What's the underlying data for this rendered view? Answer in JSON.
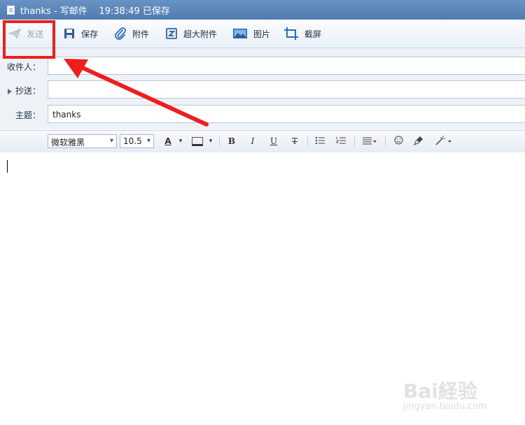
{
  "window": {
    "title": "thanks - 写邮件    19:38:49 已保存",
    "icon": "document-icon"
  },
  "toolbar": {
    "send_label": "发送",
    "save_label": "保存",
    "attach_label": "附件",
    "big_attach_label": "超大附件",
    "image_label": "图片",
    "screenshot_label": "截屏"
  },
  "fields": {
    "to_label": "收件人：",
    "to_value": "",
    "cc_label": "抄送：",
    "cc_value": "",
    "subject_label": "主题：",
    "subject_value": "thanks"
  },
  "format": {
    "font_family": "微软雅黑",
    "font_size": "10.5",
    "bold": "B",
    "italic": "I",
    "underline": "U",
    "strike": "T"
  },
  "editor": {
    "body": ""
  },
  "annotation": {
    "highlight_color": "#ef1d1d",
    "target": "send-button"
  },
  "watermark": {
    "logo": "Bai経验",
    "url": "jingyan.baidu.com"
  }
}
